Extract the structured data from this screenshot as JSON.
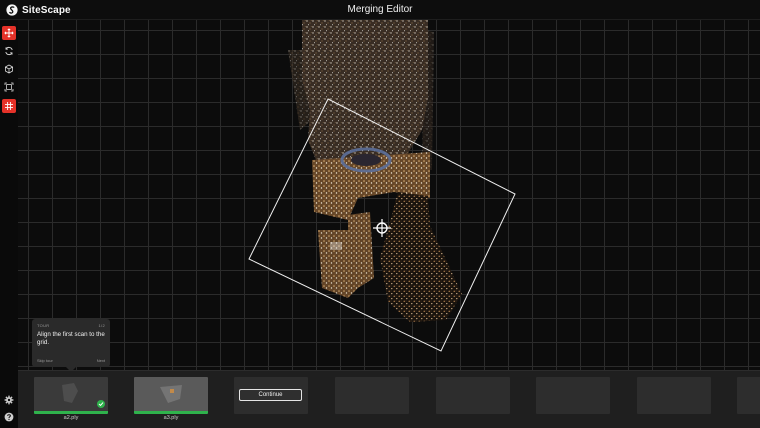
{
  "app": {
    "brand": "SiteScape",
    "title": "Merging Editor"
  },
  "colors": {
    "accent": "#e53229",
    "success": "#2fb24c",
    "grid": "#2b2b2b"
  },
  "toolbar": {
    "tools": [
      {
        "name": "move-icon",
        "active": true
      },
      {
        "name": "rotate-icon",
        "active": false
      },
      {
        "name": "cube-icon",
        "active": false
      },
      {
        "name": "fit-icon",
        "active": false
      },
      {
        "name": "grid-icon",
        "active": true
      }
    ],
    "bottom": [
      {
        "name": "gear-icon"
      },
      {
        "name": "help-icon"
      }
    ]
  },
  "tour": {
    "tag": "TOUR",
    "step": "1/2",
    "text": "Align the first scan to the grid.",
    "skip": "Skip tour",
    "next": "Next"
  },
  "filmstrip": {
    "continue_label": "Continue",
    "scans": [
      {
        "label": "a2.ply",
        "state": "done"
      },
      {
        "label": "a3.ply",
        "state": "selected"
      },
      {
        "label": "",
        "state": "continue"
      },
      {
        "label": "",
        "state": "pending"
      },
      {
        "label": "",
        "state": "pending"
      },
      {
        "label": "",
        "state": "pending"
      },
      {
        "label": "",
        "state": "pending"
      },
      {
        "label": "",
        "state": "pending"
      }
    ]
  }
}
